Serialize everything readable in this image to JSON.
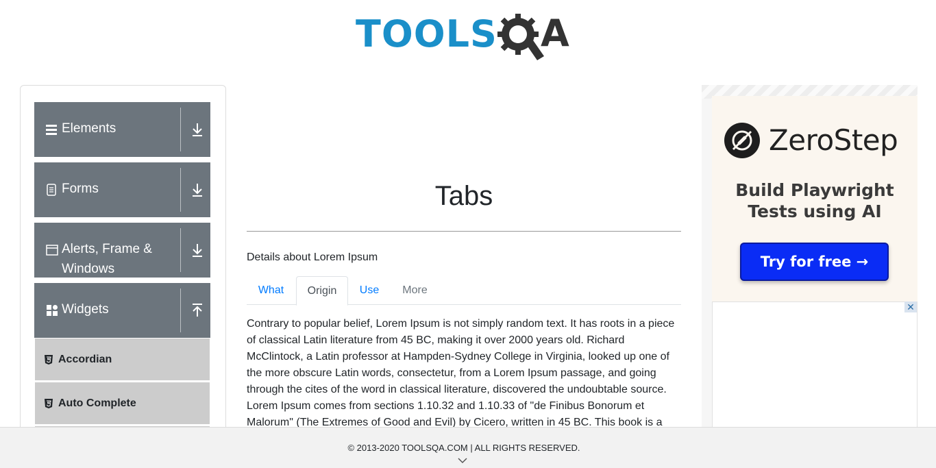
{
  "brand": {
    "logo_text_left": "TOOLS",
    "logo_text_right": "A",
    "logo_color": "#1a8fc9",
    "logo_dark": "#333333"
  },
  "sidebar": {
    "groups": [
      {
        "label": "Elements",
        "icon": "hamburger-icon",
        "arrow": "download-arrow-icon"
      },
      {
        "label": "Forms",
        "icon": "document-icon",
        "arrow": "download-arrow-icon"
      },
      {
        "label_line1": "Alerts, Frame &",
        "label_line2": "Windows",
        "icon": "window-icon",
        "arrow": "download-arrow-icon"
      },
      {
        "label": "Widgets",
        "icon": "widgets-grid-icon",
        "arrow": "upload-arrow-icon",
        "expanded": true
      }
    ],
    "widget_items": [
      {
        "label": "Accordian",
        "icon": "html5-icon"
      },
      {
        "label": "Auto Complete",
        "icon": "html5-icon"
      }
    ],
    "group_color": "#6c757d",
    "item_color": "#cccccc"
  },
  "main": {
    "title": "Tabs",
    "details": "Details about Lorem Ipsum",
    "tabs": [
      {
        "label": "What",
        "state": "normal"
      },
      {
        "label": "Origin",
        "state": "active"
      },
      {
        "label": "Use",
        "state": "normal"
      },
      {
        "label": "More",
        "state": "disabled"
      }
    ],
    "content": "Contrary to popular belief, Lorem Ipsum is not simply random text. It has roots in a piece of classical Latin literature from 45 BC, making it over 2000 years old. Richard McClintock, a Latin professor at Hampden-Sydney College in Virginia, looked up one of the more obscure Latin words, consectetur, from a Lorem Ipsum passage, and going through the cites of the word in classical literature, discovered the undoubtable source. Lorem Ipsum comes from sections 1.10.32 and 1.10.33 of \"de Finibus Bonorum et Malorum\" (The Extremes of Good and Evil) by Cicero, written in 45 BC. This book is a"
  },
  "ad": {
    "brand": "ZeroStep",
    "headline": "Build Playwright Tests using AI",
    "button": "Try for free →",
    "close": "✕",
    "button_color": "#0a2cf5"
  },
  "footer": {
    "text": "© 2013-2020 TOOLSQA.COM | ALL RIGHTS RESERVED."
  }
}
